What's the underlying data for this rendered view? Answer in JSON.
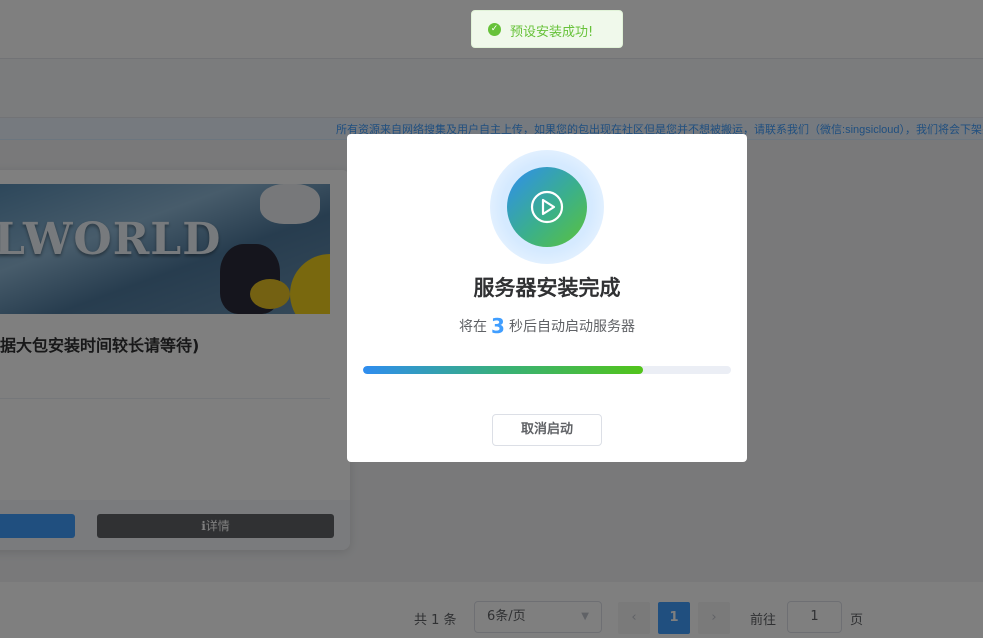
{
  "notice": {
    "text": "所有资源来自网络搜集及用户自主上传，如果您的包出现在社区但是您并不想被搬运，请联系我们（微信:singsicloud），我们将会下架并"
  },
  "card": {
    "banner_title": "LWORLD",
    "title": "据大包安装时间较长请等待)",
    "detail_label": "详情",
    "detail_icon": "info-circle-icon"
  },
  "pagination": {
    "total_label": "共 1 条",
    "page_size": "6条/页",
    "current_page": "1",
    "goto_label": "前往",
    "goto_value": "1",
    "page_suffix": "页",
    "prev_icon": "chevron-left-icon",
    "next_icon": "chevron-right-icon"
  },
  "toast": {
    "message": "预设安装成功!",
    "icon": "check-circle-icon",
    "color": "#67c23a"
  },
  "modal": {
    "icon": "play-circle-icon",
    "title": "服务器安装完成",
    "sub_before": "将在",
    "countdown": "3",
    "sub_after": "秒后自动启动服务器",
    "progress": 0.76,
    "cancel_label": "取消启动"
  },
  "colors": {
    "accent": "#409eff",
    "success": "#67c23a"
  }
}
